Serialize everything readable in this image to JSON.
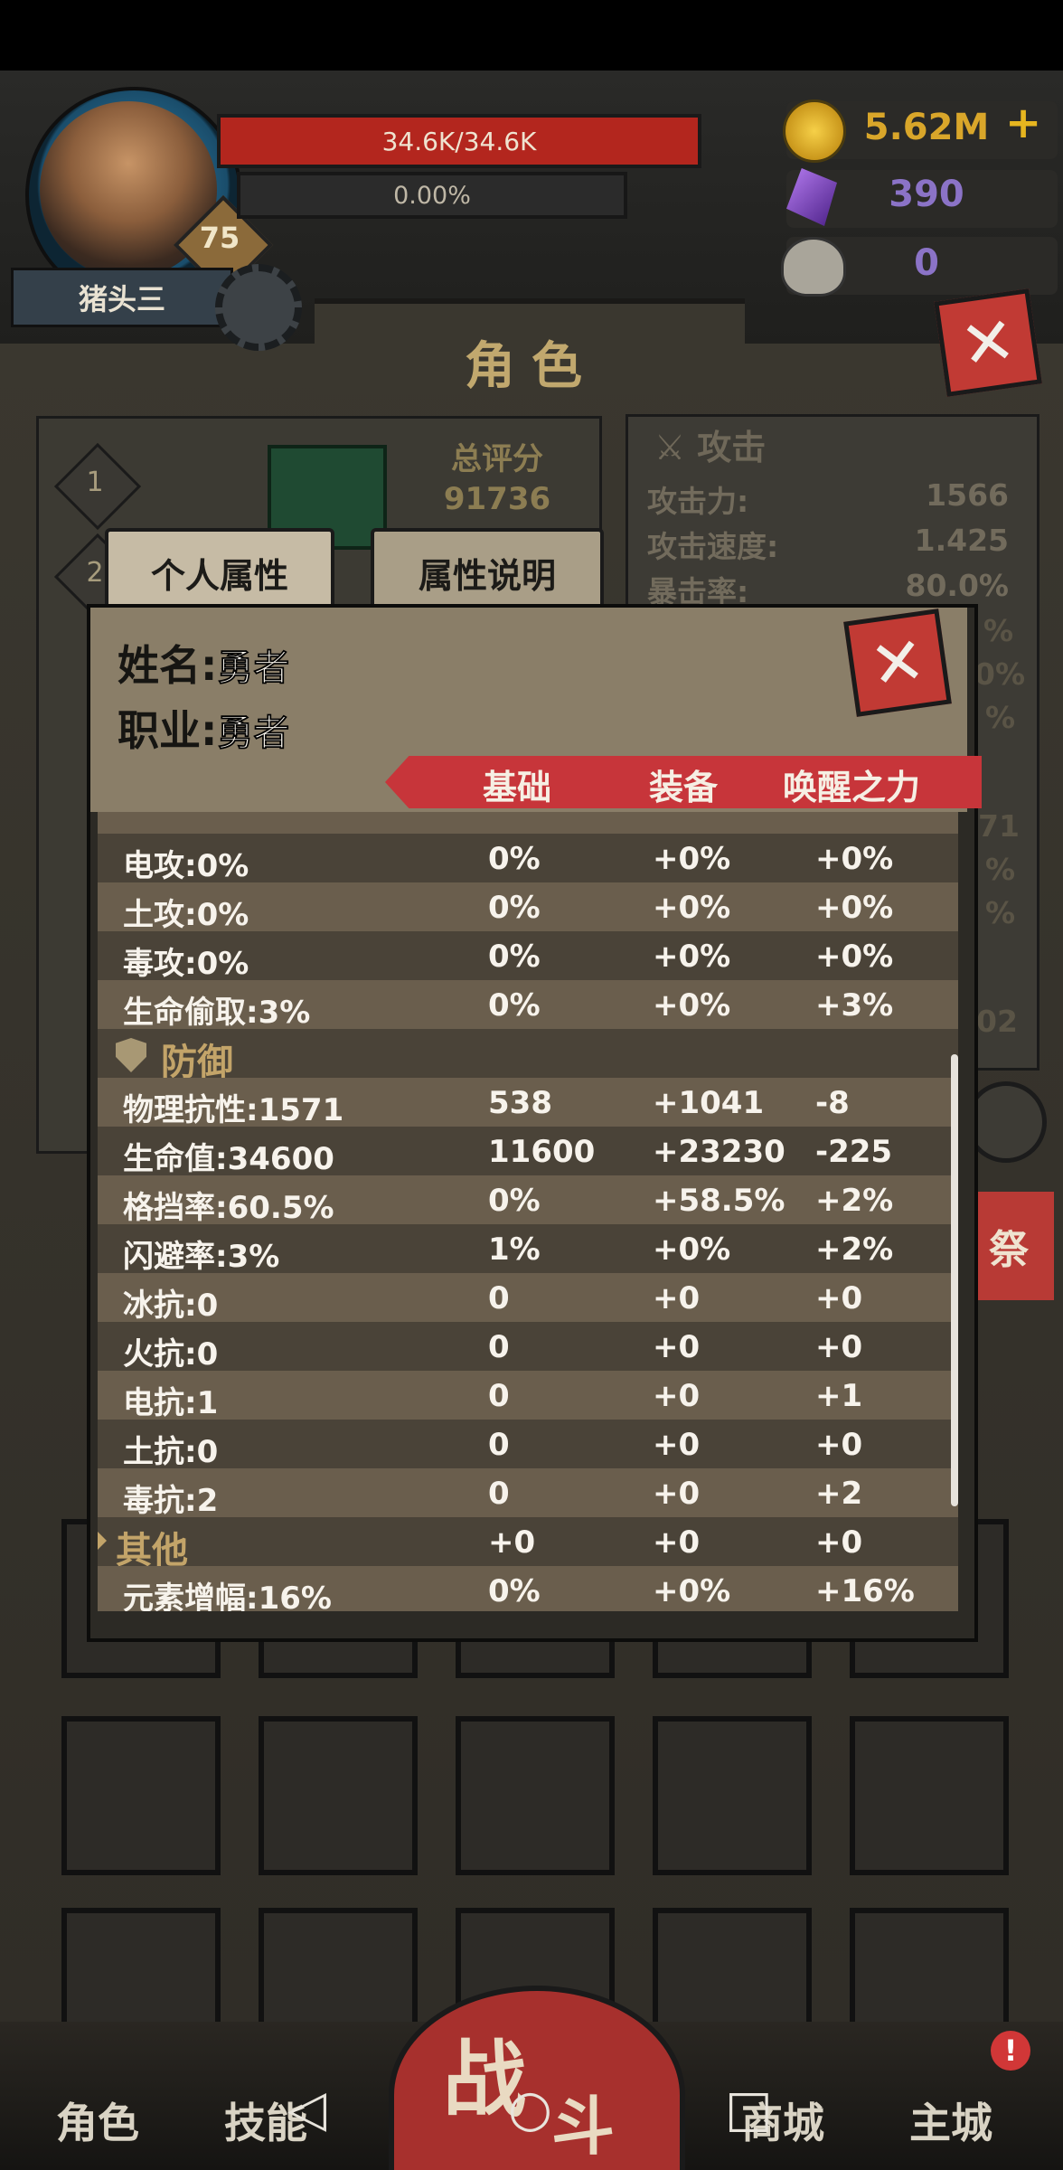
{
  "player": {
    "name": "猪头三",
    "level": "75",
    "hp": "34.6K/34.6K",
    "exp_pct": "0.00%"
  },
  "currency": {
    "gold": "5.62M",
    "gems": "390",
    "skulls": "0"
  },
  "page_title": "角色",
  "summary": {
    "score_label": "总评分",
    "score_value": "91736",
    "slot1": "1",
    "slot2": "2"
  },
  "attack_panel": {
    "title": "攻击",
    "rows": [
      {
        "label": "攻击力:",
        "value": "1566"
      },
      {
        "label": "攻击速度:",
        "value": "1.425"
      },
      {
        "label": "暴击率:",
        "value": "80.0%"
      }
    ],
    "partial_values": [
      "%",
      "0%",
      "%",
      "71",
      "%",
      "%",
      "02"
    ]
  },
  "tabs": {
    "personal": "个人属性",
    "explain": "属性说明"
  },
  "dialog": {
    "name_label": "姓名:",
    "name_value": "勇者",
    "job_label": "职业:",
    "job_value": "勇者",
    "columns": [
      "基础",
      "装备",
      "唤醒之力"
    ],
    "rows_top": [
      [
        "电攻:0%",
        "0%",
        "+0%",
        "+0%"
      ],
      [
        "土攻:0%",
        "0%",
        "+0%",
        "+0%"
      ],
      [
        "毒攻:0%",
        "0%",
        "+0%",
        "+0%"
      ],
      [
        "生命偷取:3%",
        "0%",
        "+0%",
        "+3%"
      ]
    ],
    "defense_title": "防御",
    "rows_defense": [
      [
        "物理抗性:1571",
        "538",
        "+1041",
        "-8"
      ],
      [
        "生命值:34600",
        "11600",
        "+23230",
        "-225"
      ],
      [
        "格挡率:60.5%",
        "0%",
        "+58.5%",
        "+2%"
      ],
      [
        "闪避率:3%",
        "1%",
        "+0%",
        "+2%"
      ],
      [
        "冰抗:0",
        "0",
        "+0",
        "+0"
      ],
      [
        "火抗:0",
        "0",
        "+0",
        "+0"
      ],
      [
        "电抗:1",
        "0",
        "+0",
        "+1"
      ],
      [
        "土抗:0",
        "0",
        "+0",
        "+0"
      ],
      [
        "毒抗:2",
        "0",
        "+0",
        "+2"
      ]
    ],
    "other_title": "其他",
    "other_values": [
      "+0",
      "+0",
      "+0"
    ],
    "rows_other": [
      [
        "元素增幅:16%",
        "0%",
        "+0%",
        "+16%"
      ]
    ]
  },
  "side_button": "祭",
  "bottom_nav": {
    "role": "角色",
    "skill": "技能",
    "battle_1": "战",
    "battle_2": "斗",
    "shop": "商城",
    "castle": "主城",
    "castle_badge": "!"
  },
  "system_nav": {
    "back": "◁",
    "home": "○",
    "recent": "□"
  }
}
